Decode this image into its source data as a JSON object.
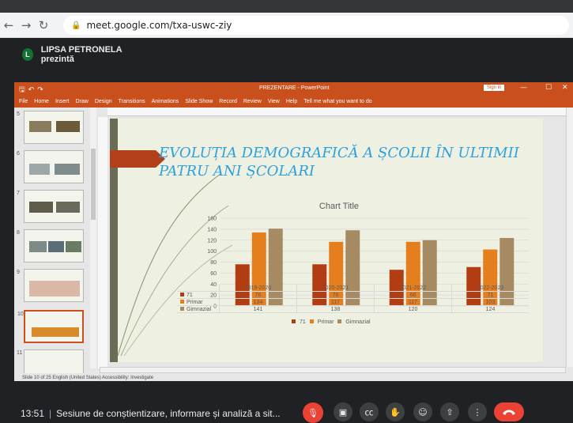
{
  "browser": {
    "url": "meet.google.com/txa-uswc-ziy"
  },
  "meet": {
    "presenter_initial": "L",
    "presenter_label": "LIPSA PETRONELA prezintă",
    "time": "13:51",
    "meeting_title": "Sesiune de conștientizare, informare și analiză a sit...",
    "controls": [
      "mic-off-icon",
      "camera-icon",
      "captions-icon",
      "raise-hand-icon",
      "emoji-icon",
      "present-icon",
      "more-icon",
      "hang-up-icon"
    ]
  },
  "powerpoint": {
    "title_bar": "PREZENTARE - PowerPoint",
    "sign_in": "Sign in",
    "ribbon_tabs": [
      "File",
      "Home",
      "Insert",
      "Draw",
      "Design",
      "Transitions",
      "Animations",
      "Slide Show",
      "Record",
      "Review",
      "View",
      "Help",
      "Tell me what you want to do"
    ],
    "thumbnails": [
      "5",
      "6",
      "7",
      "8",
      "9",
      "10",
      "11"
    ],
    "status": "Slide 10 of 25    English (United States)    Accessibility: Investigate"
  },
  "slide": {
    "title": "EVOLUȚIA DEMOGRAFICĂ A ȘCOLII ÎN ULTIMII PATRU ANI ȘCOLARI"
  },
  "chart_data": {
    "type": "bar",
    "title": "Chart Title",
    "categories": [
      "2019-2020",
      "2020-2021",
      "2021-2022",
      "2022-2023"
    ],
    "series": [
      {
        "name": "71",
        "values": [
          76,
          76,
          66,
          71
        ],
        "color": "#b23d12"
      },
      {
        "name": "Primar",
        "values": [
          134,
          117,
          117,
          103
        ],
        "color": "#e57f1e"
      },
      {
        "name": "Gimnazial",
        "values": [
          141,
          138,
          120,
          124
        ],
        "color": "#a58a62"
      }
    ],
    "ylim": [
      0,
      160
    ],
    "yticks": [
      "0",
      "20",
      "40",
      "60",
      "80",
      "100",
      "120",
      "140",
      "160"
    ],
    "grid": true,
    "legend": "bottom"
  }
}
